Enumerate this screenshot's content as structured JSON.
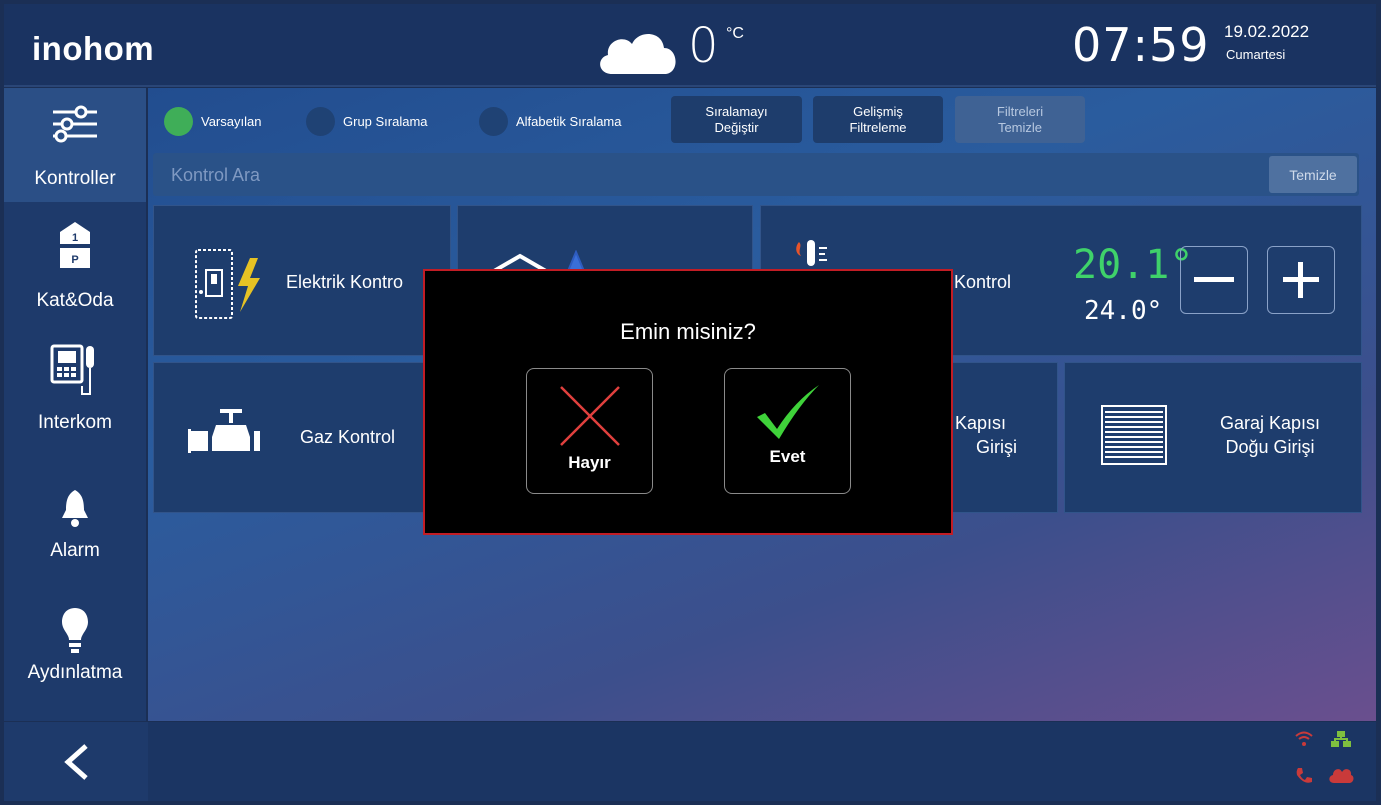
{
  "header": {
    "logo": "inohom",
    "temperature": "0",
    "temperature_unit": "°C",
    "time": "07:59",
    "date": "19.02.2022",
    "day": "Cumartesi",
    "weather_icon": "cloud-icon"
  },
  "sidebar": {
    "items": [
      {
        "label": "Kontroller",
        "icon": "sliders-icon"
      },
      {
        "label": "Kat&Oda",
        "icon": "floor-room-icon"
      },
      {
        "label": "Interkom",
        "icon": "intercom-icon"
      },
      {
        "label": "Alarm",
        "icon": "bell-icon"
      },
      {
        "label": "Aydınlatma",
        "icon": "lightbulb-icon"
      }
    ],
    "back_icon": "chevron-left-icon"
  },
  "sort_options": [
    {
      "label": "Varsayılan",
      "selected": true
    },
    {
      "label": "Grup Sıralama",
      "selected": false
    },
    {
      "label": "Alfabetik Sıralama",
      "selected": false
    }
  ],
  "toolbar": {
    "change_sort": [
      "Sıralamayı",
      "Değiştir"
    ],
    "advanced_filter": [
      "Gelişmiş",
      "Filtreleme"
    ],
    "clear_filters": [
      "Filtreleri",
      "Temizle"
    ]
  },
  "search": {
    "placeholder": "Kontrol Ara",
    "clear_label": "Temizle"
  },
  "tiles": {
    "electric": "Elektrik Kontro",
    "heating_partial": "a Kontrol",
    "current_temp": "20.1°",
    "set_temp": "24.0°",
    "gas": "Gaz Kontrol",
    "garage_partial_1": "j Kapısı",
    "garage_partial_2": "Girişi",
    "garage_east_1": "Garaj Kapısı",
    "garage_east_2": "Doğu Girişi"
  },
  "dialog": {
    "title": "Emin misiniz?",
    "no_label": "Hayır",
    "yes_label": "Evet"
  },
  "colors": {
    "accent_green": "#3fae58",
    "dialog_border": "#c21d25",
    "temp_green": "#3fd26a"
  }
}
